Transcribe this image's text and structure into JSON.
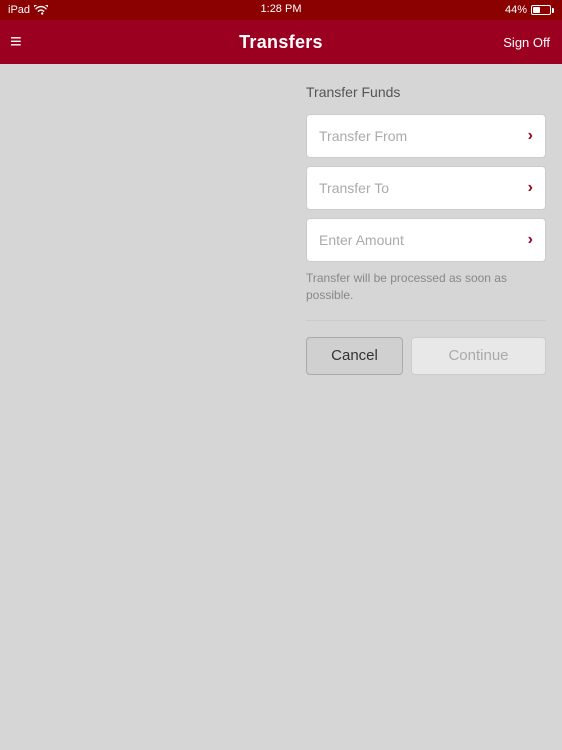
{
  "status_bar": {
    "device": "iPad",
    "time": "1:28 PM",
    "battery_pct": "44%",
    "wifi": true
  },
  "nav": {
    "title": "Transfers",
    "sign_off_label": "Sign Off",
    "menu_icon": "≡"
  },
  "transfer_section": {
    "title": "Transfer Funds",
    "transfer_from_placeholder": "Transfer From",
    "transfer_to_placeholder": "Transfer To",
    "enter_amount_placeholder": "Enter Amount",
    "info_text": "Transfer will be processed as soon as possible.",
    "chevron": "›"
  },
  "buttons": {
    "cancel_label": "Cancel",
    "continue_label": "Continue"
  }
}
